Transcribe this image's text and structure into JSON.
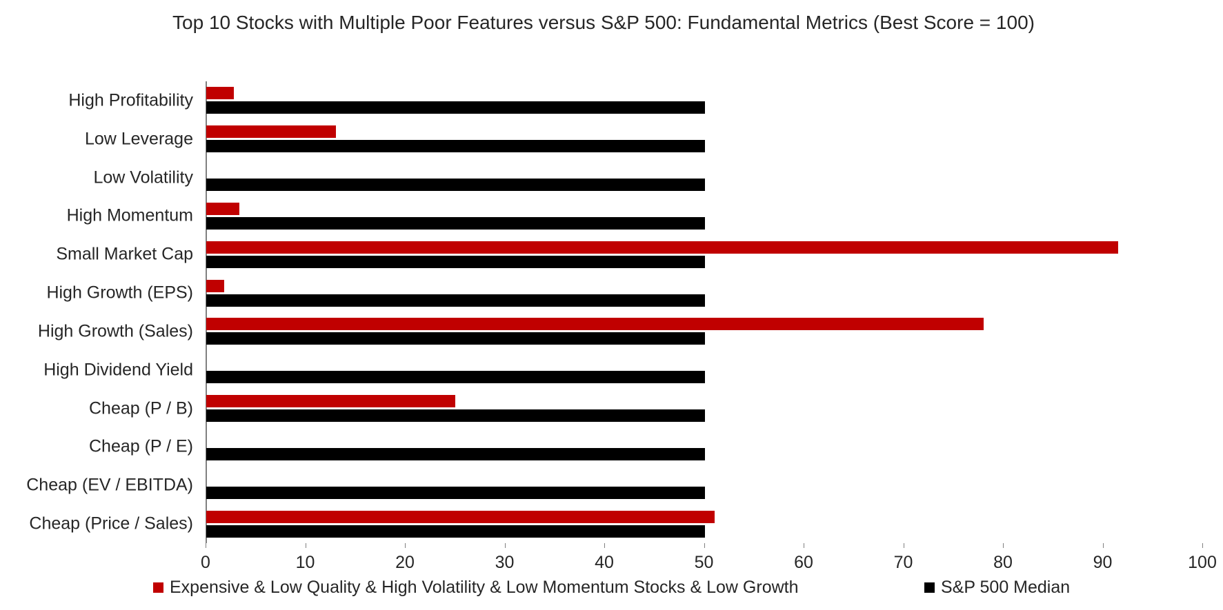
{
  "chart_data": {
    "type": "bar",
    "orientation": "horizontal",
    "title": "Top 10 Stocks with Multiple Poor Features versus S&P 500: Fundamental Metrics (Best Score = 100)",
    "xlabel": "",
    "ylabel": "",
    "xlim": [
      0,
      100
    ],
    "xticks": [
      0,
      10,
      20,
      30,
      40,
      50,
      60,
      70,
      80,
      90,
      100
    ],
    "xtick_labels": [
      "0",
      "10",
      "20",
      "30",
      "40",
      "50",
      "60",
      "70",
      "80",
      "90",
      "100"
    ],
    "grid": false,
    "legend_position": "bottom",
    "categories": [
      "High Profitability",
      "Low Leverage",
      "Low Volatility",
      "High Momentum",
      "Small Market Cap",
      "High Growth (EPS)",
      "High Growth (Sales)",
      "High Dividend Yield",
      "Cheap (P / B)",
      "Cheap (P / E)",
      "Cheap (EV / EBITDA)",
      "Cheap (Price / Sales)"
    ],
    "series": [
      {
        "name": "Expensive & Low Quality & High Volatility & Low Momentum Stocks & Low Growth",
        "color": "#C00000",
        "values": [
          2.8,
          13.0,
          0.0,
          3.3,
          91.5,
          1.8,
          78.0,
          0.0,
          25.0,
          0.0,
          0.0,
          51.0
        ]
      },
      {
        "name": "S&P 500 Median",
        "color": "#000000",
        "values": [
          50,
          50,
          50,
          50,
          50,
          50,
          50,
          50,
          50,
          50,
          50,
          50
        ]
      }
    ]
  }
}
